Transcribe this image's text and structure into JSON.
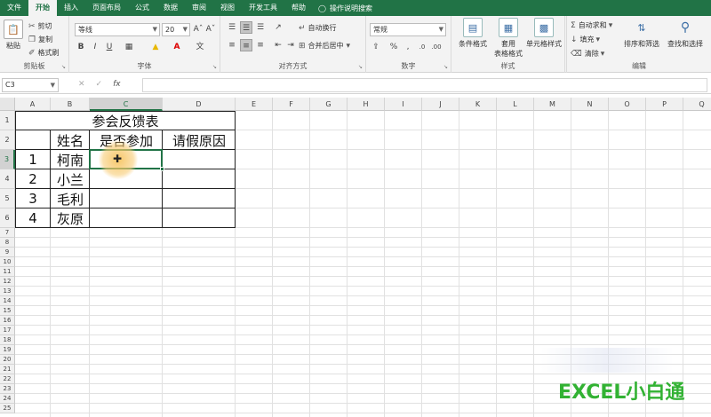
{
  "menu": {
    "tabs": [
      "文件",
      "开始",
      "插入",
      "页面布局",
      "公式",
      "数据",
      "审阅",
      "视图",
      "开发工具",
      "帮助"
    ],
    "active_index": 1,
    "tell_me": "操作说明搜索"
  },
  "ribbon": {
    "clipboard": {
      "paste": "粘贴",
      "cut": "剪切",
      "copy": "复制",
      "format_painter": "格式刷",
      "label": "剪贴板"
    },
    "font": {
      "name": "等线",
      "size": "20",
      "bold": "B",
      "italic": "I",
      "underline": "U",
      "label": "字体"
    },
    "alignment": {
      "wrap": "自动换行",
      "merge": "合并后居中",
      "label": "对齐方式"
    },
    "number": {
      "format": "常规",
      "label": "数字"
    },
    "styles": {
      "conditional": "条件格式",
      "table_line1": "套用",
      "table_line2": "表格格式",
      "cell_styles": "单元格样式",
      "label": "样式"
    },
    "editing": {
      "autosum": "自动求和",
      "fill": "填充",
      "clear": "清除",
      "sort": "排序和筛选",
      "find": "查找和选择",
      "label": "编辑"
    }
  },
  "formula_bar": {
    "name_box": "C3",
    "fx": "fx",
    "value": ""
  },
  "columns": [
    "A",
    "B",
    "C",
    "D",
    "E",
    "F",
    "G",
    "H",
    "I",
    "J",
    "K",
    "L",
    "M",
    "N",
    "O",
    "P",
    "Q"
  ],
  "selected_column": "C",
  "rows": [
    "1",
    "2",
    "3",
    "4",
    "5",
    "6",
    "7",
    "8",
    "9",
    "10",
    "11",
    "12",
    "13",
    "14",
    "15",
    "16",
    "17",
    "18",
    "19",
    "20",
    "21",
    "22",
    "23",
    "24",
    "25"
  ],
  "selected_row": "3",
  "sheet_table": {
    "title": "参会反馈表",
    "headers": [
      "姓名",
      "是否参加",
      "请假原因"
    ],
    "rows": [
      {
        "no": "1",
        "name": "柯南"
      },
      {
        "no": "2",
        "name": "小兰"
      },
      {
        "no": "3",
        "name": "毛利"
      },
      {
        "no": "4",
        "name": "灰原"
      }
    ]
  },
  "watermark": "EXCEL小白通",
  "colors": {
    "excel_green": "#217346",
    "watermark_green": "#32b233"
  }
}
